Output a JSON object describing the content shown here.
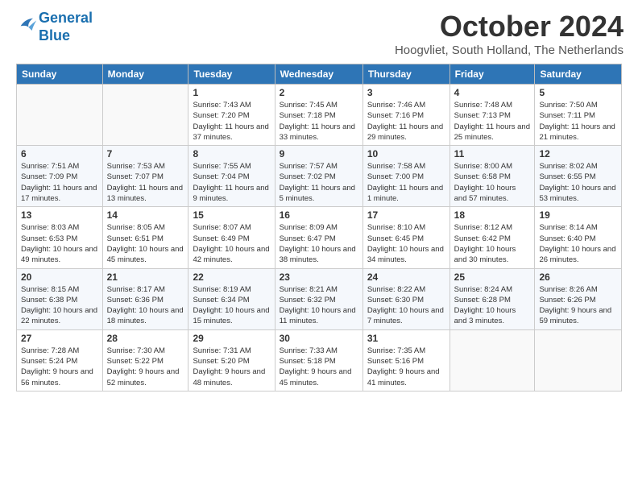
{
  "header": {
    "logo_line1": "General",
    "logo_line2": "Blue",
    "month": "October 2024",
    "location": "Hoogvliet, South Holland, The Netherlands"
  },
  "weekdays": [
    "Sunday",
    "Monday",
    "Tuesday",
    "Wednesday",
    "Thursday",
    "Friday",
    "Saturday"
  ],
  "weeks": [
    [
      {
        "day": "",
        "info": ""
      },
      {
        "day": "",
        "info": ""
      },
      {
        "day": "1",
        "info": "Sunrise: 7:43 AM\nSunset: 7:20 PM\nDaylight: 11 hours\nand 37 minutes."
      },
      {
        "day": "2",
        "info": "Sunrise: 7:45 AM\nSunset: 7:18 PM\nDaylight: 11 hours\nand 33 minutes."
      },
      {
        "day": "3",
        "info": "Sunrise: 7:46 AM\nSunset: 7:16 PM\nDaylight: 11 hours\nand 29 minutes."
      },
      {
        "day": "4",
        "info": "Sunrise: 7:48 AM\nSunset: 7:13 PM\nDaylight: 11 hours\nand 25 minutes."
      },
      {
        "day": "5",
        "info": "Sunrise: 7:50 AM\nSunset: 7:11 PM\nDaylight: 11 hours\nand 21 minutes."
      }
    ],
    [
      {
        "day": "6",
        "info": "Sunrise: 7:51 AM\nSunset: 7:09 PM\nDaylight: 11 hours\nand 17 minutes."
      },
      {
        "day": "7",
        "info": "Sunrise: 7:53 AM\nSunset: 7:07 PM\nDaylight: 11 hours\nand 13 minutes."
      },
      {
        "day": "8",
        "info": "Sunrise: 7:55 AM\nSunset: 7:04 PM\nDaylight: 11 hours\nand 9 minutes."
      },
      {
        "day": "9",
        "info": "Sunrise: 7:57 AM\nSunset: 7:02 PM\nDaylight: 11 hours\nand 5 minutes."
      },
      {
        "day": "10",
        "info": "Sunrise: 7:58 AM\nSunset: 7:00 PM\nDaylight: 11 hours\nand 1 minute."
      },
      {
        "day": "11",
        "info": "Sunrise: 8:00 AM\nSunset: 6:58 PM\nDaylight: 10 hours\nand 57 minutes."
      },
      {
        "day": "12",
        "info": "Sunrise: 8:02 AM\nSunset: 6:55 PM\nDaylight: 10 hours\nand 53 minutes."
      }
    ],
    [
      {
        "day": "13",
        "info": "Sunrise: 8:03 AM\nSunset: 6:53 PM\nDaylight: 10 hours\nand 49 minutes."
      },
      {
        "day": "14",
        "info": "Sunrise: 8:05 AM\nSunset: 6:51 PM\nDaylight: 10 hours\nand 45 minutes."
      },
      {
        "day": "15",
        "info": "Sunrise: 8:07 AM\nSunset: 6:49 PM\nDaylight: 10 hours\nand 42 minutes."
      },
      {
        "day": "16",
        "info": "Sunrise: 8:09 AM\nSunset: 6:47 PM\nDaylight: 10 hours\nand 38 minutes."
      },
      {
        "day": "17",
        "info": "Sunrise: 8:10 AM\nSunset: 6:45 PM\nDaylight: 10 hours\nand 34 minutes."
      },
      {
        "day": "18",
        "info": "Sunrise: 8:12 AM\nSunset: 6:42 PM\nDaylight: 10 hours\nand 30 minutes."
      },
      {
        "day": "19",
        "info": "Sunrise: 8:14 AM\nSunset: 6:40 PM\nDaylight: 10 hours\nand 26 minutes."
      }
    ],
    [
      {
        "day": "20",
        "info": "Sunrise: 8:15 AM\nSunset: 6:38 PM\nDaylight: 10 hours\nand 22 minutes."
      },
      {
        "day": "21",
        "info": "Sunrise: 8:17 AM\nSunset: 6:36 PM\nDaylight: 10 hours\nand 18 minutes."
      },
      {
        "day": "22",
        "info": "Sunrise: 8:19 AM\nSunset: 6:34 PM\nDaylight: 10 hours\nand 15 minutes."
      },
      {
        "day": "23",
        "info": "Sunrise: 8:21 AM\nSunset: 6:32 PM\nDaylight: 10 hours\nand 11 minutes."
      },
      {
        "day": "24",
        "info": "Sunrise: 8:22 AM\nSunset: 6:30 PM\nDaylight: 10 hours\nand 7 minutes."
      },
      {
        "day": "25",
        "info": "Sunrise: 8:24 AM\nSunset: 6:28 PM\nDaylight: 10 hours\nand 3 minutes."
      },
      {
        "day": "26",
        "info": "Sunrise: 8:26 AM\nSunset: 6:26 PM\nDaylight: 9 hours\nand 59 minutes."
      }
    ],
    [
      {
        "day": "27",
        "info": "Sunrise: 7:28 AM\nSunset: 5:24 PM\nDaylight: 9 hours\nand 56 minutes."
      },
      {
        "day": "28",
        "info": "Sunrise: 7:30 AM\nSunset: 5:22 PM\nDaylight: 9 hours\nand 52 minutes."
      },
      {
        "day": "29",
        "info": "Sunrise: 7:31 AM\nSunset: 5:20 PM\nDaylight: 9 hours\nand 48 minutes."
      },
      {
        "day": "30",
        "info": "Sunrise: 7:33 AM\nSunset: 5:18 PM\nDaylight: 9 hours\nand 45 minutes."
      },
      {
        "day": "31",
        "info": "Sunrise: 7:35 AM\nSunset: 5:16 PM\nDaylight: 9 hours\nand 41 minutes."
      },
      {
        "day": "",
        "info": ""
      },
      {
        "day": "",
        "info": ""
      }
    ]
  ]
}
